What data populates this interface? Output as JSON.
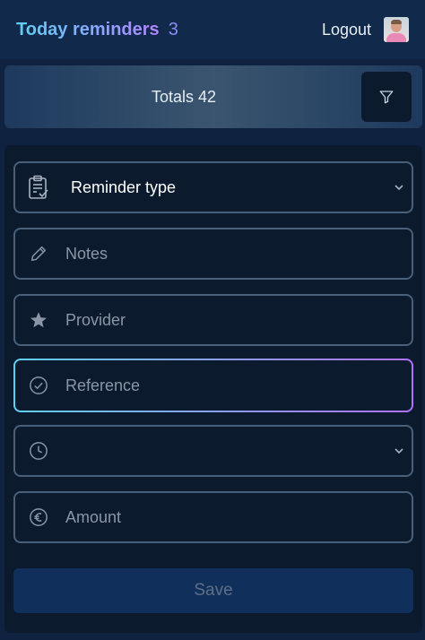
{
  "header": {
    "title": "Today reminders",
    "count": "3",
    "logout_label": "Logout"
  },
  "totals": {
    "text": "Totals 42"
  },
  "form": {
    "reminder_type": {
      "value": "Reminder type"
    },
    "notes": {
      "placeholder": "Notes"
    },
    "provider": {
      "placeholder": "Provider"
    },
    "reference": {
      "placeholder": "Reference"
    },
    "time": {
      "value": ""
    },
    "amount": {
      "placeholder": "Amount"
    },
    "save_label": "Save"
  },
  "icons": {
    "filter": "filter-icon",
    "reminder_type": "clipboard-check-icon",
    "notes": "pencil-icon",
    "provider": "star-icon",
    "reference": "check-circle-icon",
    "time": "clock-icon",
    "amount": "euro-icon",
    "dropdown": "chevron-down-icon"
  },
  "colors": {
    "background": "#0f2340",
    "panel": "#0c1a2d",
    "field_border": "#4a5f78",
    "focus_gradient_start": "#5fd0f0",
    "focus_gradient_end": "#b070ff",
    "save_button": "#102f5a"
  }
}
